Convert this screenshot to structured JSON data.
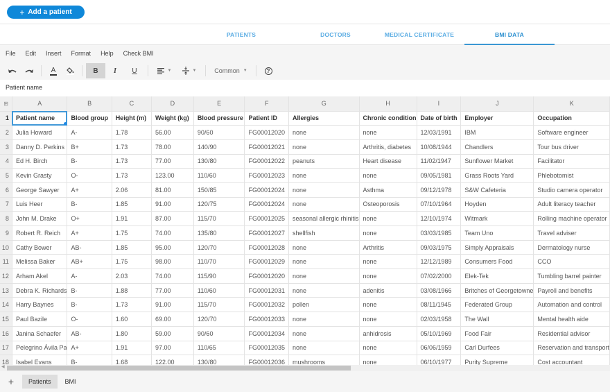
{
  "header": {
    "add_patient_label": "Add a patient",
    "plus_icon": "+"
  },
  "tabs": [
    {
      "label": "PATIENTS",
      "active": false
    },
    {
      "label": "DOCTORS",
      "active": false
    },
    {
      "label": "MEDICAL CERTIFICATE",
      "active": false
    },
    {
      "label": "BMI DATA",
      "active": true
    }
  ],
  "menu": [
    "File",
    "Edit",
    "Insert",
    "Format",
    "Help",
    "Check BMI"
  ],
  "toolbar": {
    "undo_icon": "undo-icon",
    "redo_icon": "redo-icon",
    "text_color_icon": "A",
    "fill_icon": "fill-color-icon",
    "bold_label": "B",
    "italic_label": "I",
    "underline_label": "U",
    "format_label": "Common",
    "help_icon": "?"
  },
  "formula_bar": {
    "value": "Patient name"
  },
  "grid": {
    "corner_icon": "select-all-icon",
    "columns": [
      "A",
      "B",
      "C",
      "D",
      "E",
      "F",
      "G",
      "H",
      "I",
      "J",
      "K"
    ],
    "rows": [
      [
        "1",
        "Patient name",
        "Blood group",
        "Height (m)",
        "Weight (kg)",
        "Blood pressure",
        "Patient ID",
        "Allergies",
        "Chronic condition",
        "Date of birth",
        "Employer",
        "Occupation"
      ],
      [
        "2",
        "Julia Howard",
        "A-",
        "1.78",
        "56.00",
        "90/60",
        "FG00012020",
        "none",
        "none",
        "12/03/1991",
        "IBM",
        "Software engineer"
      ],
      [
        "3",
        "Danny D. Perkins",
        "B+",
        "1.73",
        "78.00",
        "140/90",
        "FG00012021",
        "none",
        "Arthritis, diabetes",
        "10/08/1944",
        "Chandlers",
        "Tour bus driver"
      ],
      [
        "4",
        "Ed H. Birch",
        "B-",
        "1.73",
        "77.00",
        "130/80",
        "FG00012022",
        "peanuts",
        "Heart disease",
        "11/02/1947",
        "Sunflower Market",
        "Facilitator"
      ],
      [
        "5",
        "Kevin Grasty",
        "O-",
        "1.73",
        "123.00",
        "110/60",
        "FG00012023",
        "none",
        "none",
        "09/05/1981",
        "Grass Roots Yard",
        "Phlebotomist"
      ],
      [
        "6",
        "George Sawyer",
        "A+",
        "2.06",
        "81.00",
        "150/85",
        "FG00012024",
        "none",
        "Asthma",
        "09/12/1978",
        "S&W Cafeteria",
        "Studio camera operator"
      ],
      [
        "7",
        "Luis Heer",
        "B-",
        "1.85",
        "91.00",
        "120/75",
        "FG00012024",
        "none",
        "Osteoporosis",
        "07/10/1964",
        "Hoyden",
        "Adult literacy teacher"
      ],
      [
        "8",
        "John M. Drake",
        "O+",
        "1.91",
        "87.00",
        "115/70",
        "FG00012025",
        "seasonal allergic rhinitis",
        "none",
        "12/10/1974",
        "Witmark",
        "Rolling machine operator"
      ],
      [
        "9",
        "Robert R. Reich",
        "A+",
        "1.75",
        "74.00",
        "135/80",
        "FG00012027",
        "shellfish",
        "none",
        "03/03/1985",
        "Team Uno",
        "Travel adviser"
      ],
      [
        "10",
        "Cathy Bower",
        "AB-",
        "1.85",
        "95.00",
        "120/70",
        "FG00012028",
        "none",
        "Arthritis",
        "09/03/1975",
        "Simply Appraisals",
        "Dermatology nurse"
      ],
      [
        "11",
        "Melissa Baker",
        "AB+",
        "1.75",
        "98.00",
        "110/70",
        "FG00012029",
        "none",
        "none",
        "12/12/1989",
        "Consumers Food",
        "CCO"
      ],
      [
        "12",
        "Arham Akel",
        "A-",
        "2.03",
        "74.00",
        "115/90",
        "FG00012020",
        "none",
        "none",
        "07/02/2000",
        "Elek-Tek",
        "Tumbling barrel painter"
      ],
      [
        "13",
        "Debra K. Richards",
        "B-",
        "1.88",
        "77.00",
        "110/60",
        "FG00012031",
        "none",
        "adenitis",
        "03/08/1966",
        "Britches of Georgetowne",
        "Payroll and benefits"
      ],
      [
        "14",
        "Harry Baynes",
        "B-",
        "1.73",
        "91.00",
        "115/70",
        "FG00012032",
        "pollen",
        "none",
        "08/11/1945",
        "Federated Group",
        "Automation and control"
      ],
      [
        "15",
        "Paul Bazile",
        "O-",
        "1.60",
        "69.00",
        "120/70",
        "FG00012033",
        "none",
        "none",
        "02/03/1958",
        "The Wall",
        "Mental health aide"
      ],
      [
        "16",
        "Janina Schaefer",
        "AB-",
        "1.80",
        "59.00",
        "90/60",
        "FG00012034",
        "none",
        "anhidrosis",
        "05/10/1969",
        "Food Fair",
        "Residential advisor"
      ],
      [
        "17",
        "Pelegrino Ávila Pa",
        "A+",
        "1.91",
        "97.00",
        "110/65",
        "FG00012035",
        "none",
        "none",
        "06/06/1959",
        "Carl Durfees",
        "Reservation and transport"
      ],
      [
        "18",
        "Isabel Evans",
        "B-",
        "1.68",
        "122.00",
        "130/80",
        "FG00012036",
        "mushrooms",
        "none",
        "06/10/1977",
        "Purity Supreme",
        "Cost accountant"
      ]
    ]
  },
  "sheets": {
    "add_icon": "+",
    "tabs": [
      {
        "label": "Patients",
        "active": true
      },
      {
        "label": "BMI",
        "active": false
      }
    ]
  }
}
